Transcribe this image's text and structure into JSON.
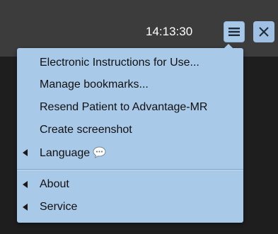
{
  "header": {
    "time": "14:13:30"
  },
  "icons": {
    "menu": "hamburger-icon",
    "close": "close-icon",
    "submenu": "chevron-left-icon",
    "language_extra": "speech-bubble-icon"
  },
  "colors": {
    "topbar": "#3c3c3c",
    "background": "#1e1e1e",
    "menu_bg": "#a9c9e8",
    "button_bg": "#a8c8e8",
    "text": "#111111"
  },
  "menu": {
    "items": [
      {
        "label": "Electronic Instructions for Use...",
        "submenu": false
      },
      {
        "label": "Manage bookmarks...",
        "submenu": false
      },
      {
        "label": "Resend Patient to Advantage-MR",
        "submenu": false
      },
      {
        "label": "Create screenshot",
        "submenu": false
      },
      {
        "label": "Language",
        "submenu": true
      },
      {
        "label": "About",
        "submenu": true
      },
      {
        "label": "Service",
        "submenu": true
      }
    ]
  }
}
